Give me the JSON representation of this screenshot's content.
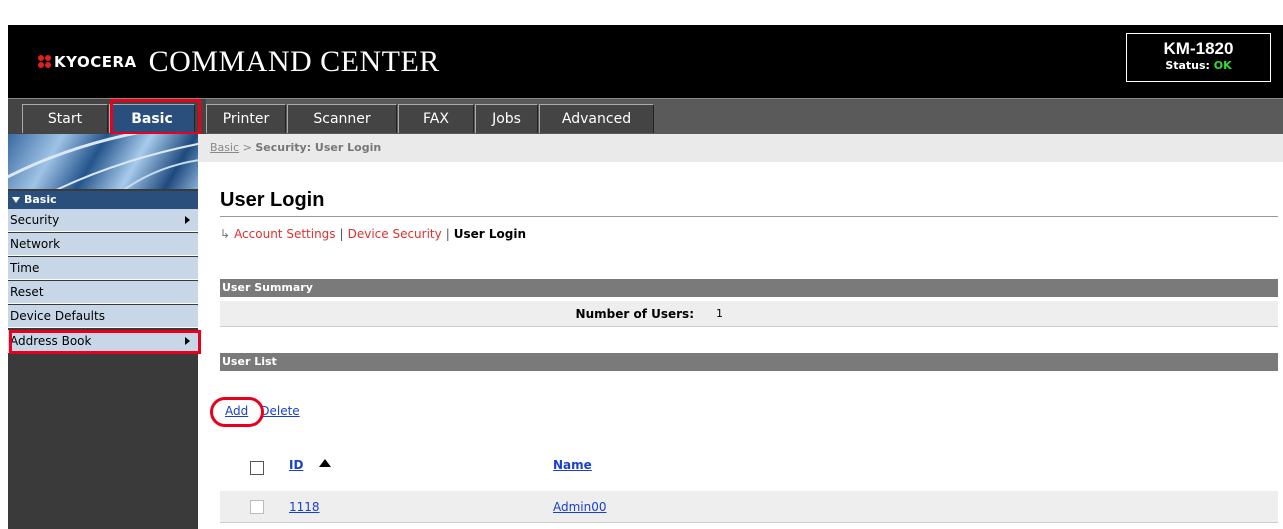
{
  "header": {
    "brand": "KYOCERA",
    "product": "COMMAND CENTER",
    "model": "KM-1820",
    "status_label": "Status:",
    "status_value": "OK"
  },
  "tabs": [
    {
      "label": "Start"
    },
    {
      "label": "Basic"
    },
    {
      "label": "Printer"
    },
    {
      "label": "Scanner"
    },
    {
      "label": "FAX"
    },
    {
      "label": "Jobs"
    },
    {
      "label": "Advanced"
    }
  ],
  "sidebar": {
    "section": "Basic",
    "items": [
      {
        "label": "Security"
      },
      {
        "label": "Network"
      },
      {
        "label": "Time"
      },
      {
        "label": "Reset"
      },
      {
        "label": "Device Defaults"
      },
      {
        "label": "Address Book"
      }
    ]
  },
  "breadcrumb": {
    "root": "Basic",
    "sep": ">",
    "current": "Security: User Login"
  },
  "page": {
    "title": "User Login",
    "subnav": {
      "account": "Account Settings",
      "device": "Device Security",
      "current": "User Login",
      "sep": "|"
    }
  },
  "summary": {
    "heading": "User Summary",
    "label": "Number of Users:",
    "value": "1"
  },
  "userlist": {
    "heading": "User List",
    "add": "Add",
    "delete": "Delete",
    "columns": {
      "id": "ID",
      "name": "Name"
    },
    "rows": [
      {
        "id": "1118",
        "name": "Admin00"
      }
    ]
  }
}
